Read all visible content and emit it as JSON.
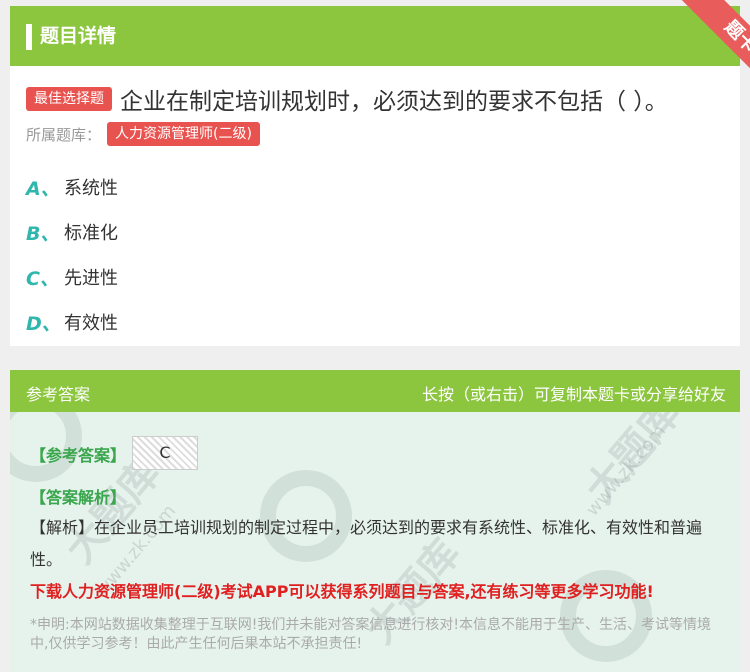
{
  "header": {
    "title": "题目详情",
    "corner_label": "题卡"
  },
  "question": {
    "type_tag": "最佳选择题",
    "text": "企业在制定培训规划时，必须达到的要求不包括（ ）。",
    "source_label": "所属题库：",
    "source_tag": "人力资源管理师(二级)",
    "options": [
      {
        "letter": "A",
        "sep": "、",
        "text": "系统性"
      },
      {
        "letter": "B",
        "sep": "、",
        "text": "标准化"
      },
      {
        "letter": "C",
        "sep": "、",
        "text": "先进性"
      },
      {
        "letter": "D",
        "sep": "、",
        "text": "有效性"
      }
    ]
  },
  "answer": {
    "head_left": "参考答案",
    "head_right": "长按（或右击）可复制本题卡或分享给好友",
    "ref_label": "【参考答案】",
    "ref_value": "C",
    "analysis_label": "【答案解析】",
    "analysis_text": "【解析】在企业员工培训规划的制定过程中，必须达到的要求有系统性、标准化、有效性和普遍性。",
    "promo": "下载人力资源管理师(二级)考试APP可以获得系列题目与答案,还有练习等更多学习功能!",
    "disclaimer": "*申明:本网站数据收集整理于互联网!我们并未能对答案信息进行核对!本信息不能用于生产、生活、考试等情境中,仅供学习参考！由此产生任何后果本站不承担责任!"
  },
  "colors": {
    "accent_green": "#8cc63f",
    "tag_red": "#e9534f",
    "option_letter": "#2fb6ad",
    "promo_red": "#e02020"
  }
}
